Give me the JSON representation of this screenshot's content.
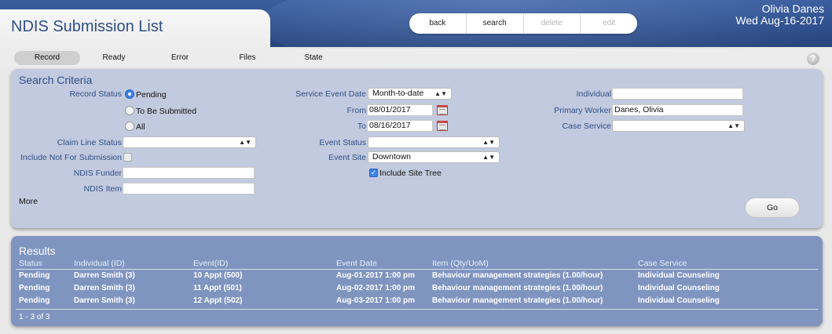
{
  "header": {
    "title": "NDIS Submission List",
    "user_name": "Olivia Danes",
    "date": "Wed Aug-16-2017",
    "buttons": {
      "back": "back",
      "search": "search",
      "delete": "delete",
      "edit": "edit"
    }
  },
  "tabs": [
    "Record",
    "Ready",
    "Error",
    "Files",
    "State"
  ],
  "active_tab": "Record",
  "help_icon": "?",
  "search": {
    "title": "Search Criteria",
    "record_status_label": "Record Status",
    "record_status_options": [
      "Pending",
      "To Be Submitted",
      "All"
    ],
    "record_status_selected": "Pending",
    "claim_line_status_label": "Claim Line Status",
    "claim_line_status_value": "",
    "include_not_for_submission_label": "Include Not For Submission",
    "include_not_for_submission_checked": false,
    "ndis_funder_label": "NDIS Funder",
    "ndis_funder_value": "",
    "ndis_item_label": "NDIS Item",
    "ndis_item_value": "",
    "more_label": "More",
    "service_event_date_label": "Service Event Date",
    "service_event_date_value": "Month-to-date",
    "from_label": "From",
    "from_value": "08/01/2017",
    "to_label": "To",
    "to_value": "08/16/2017",
    "event_status_label": "Event Status",
    "event_status_value": "",
    "event_site_label": "Event Site",
    "event_site_value": "Downtown",
    "include_site_tree_label": "Include Site Tree",
    "include_site_tree_checked": true,
    "individual_label": "Individual",
    "individual_value": "",
    "primary_worker_label": "Primary Worker",
    "primary_worker_value": "Danes, Olivia",
    "case_service_label": "Case Service",
    "case_service_value": "",
    "go_label": "Go"
  },
  "results": {
    "title": "Results",
    "columns": [
      "Status",
      "Individual (ID)",
      "Event(ID)",
      "Event Date",
      "Item (Qty/UoM)",
      "Case Service"
    ],
    "rows": [
      [
        "Pending",
        "Darren Smith (3)",
        "10 Appt (500)",
        "Aug-01-2017 1:00 pm",
        "Behaviour management strategies (1.00/hour)",
        "Individual Counseling"
      ],
      [
        "Pending",
        "Darren Smith (3)",
        "11 Appt (501)",
        "Aug-02-2017 1:00 pm",
        "Behaviour management strategies (1.00/hour)",
        "Individual Counseling"
      ],
      [
        "Pending",
        "Darren Smith (3)",
        "12 Appt (502)",
        "Aug-03-2017 1:00 pm",
        "Behaviour management strategies (1.00/hour)",
        "Individual Counseling"
      ]
    ],
    "pagination": "1 - 3 of 3"
  }
}
